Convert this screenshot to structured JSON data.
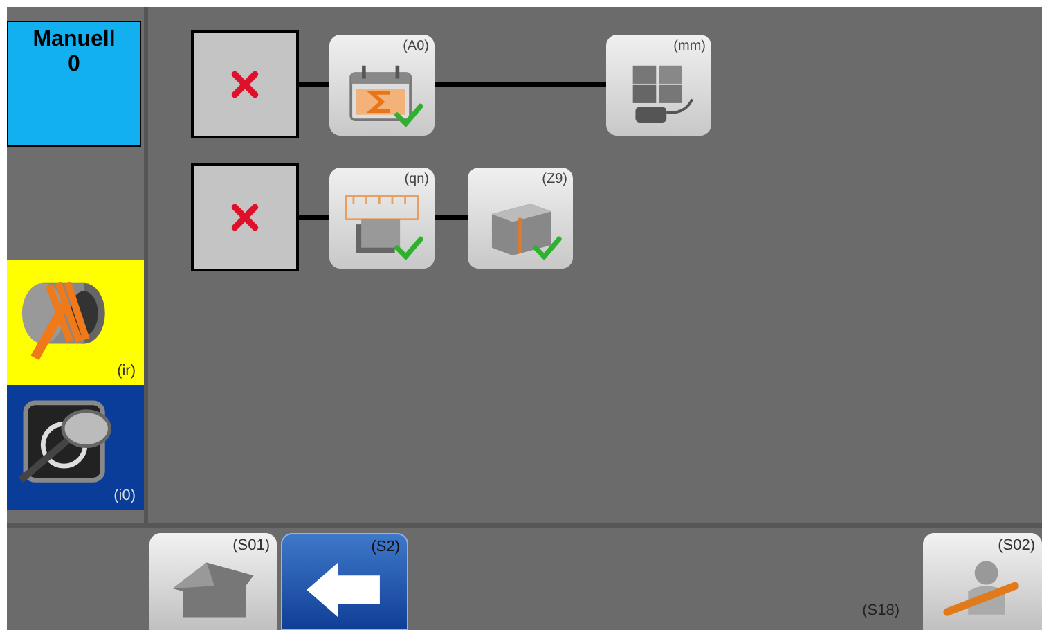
{
  "mode": {
    "label": "Manuell",
    "value": "0"
  },
  "side_tiles": [
    {
      "kind": "coil",
      "label": "(ir)",
      "color": "#ffff00"
    },
    {
      "kind": "inspect",
      "label": "(i0)",
      "color": "#0a3d9a"
    }
  ],
  "flows": [
    {
      "failed": true,
      "steps": [
        {
          "kind": "calendar",
          "label": "(A0)",
          "done": true
        },
        {
          "kind": "blocks",
          "label": "(mm)",
          "done": false
        }
      ]
    },
    {
      "failed": true,
      "steps": [
        {
          "kind": "ruler",
          "label": "(qn)",
          "done": true
        },
        {
          "kind": "cube",
          "label": "(Z9)",
          "done": true
        }
      ]
    }
  ],
  "bottom_buttons": [
    {
      "kind": "home",
      "label": "(S01)",
      "selected": false
    },
    {
      "kind": "back",
      "label": "(S2)",
      "selected": true
    }
  ],
  "service_note": "(S18)",
  "service_button": {
    "kind": "service",
    "label": "(S02)"
  }
}
